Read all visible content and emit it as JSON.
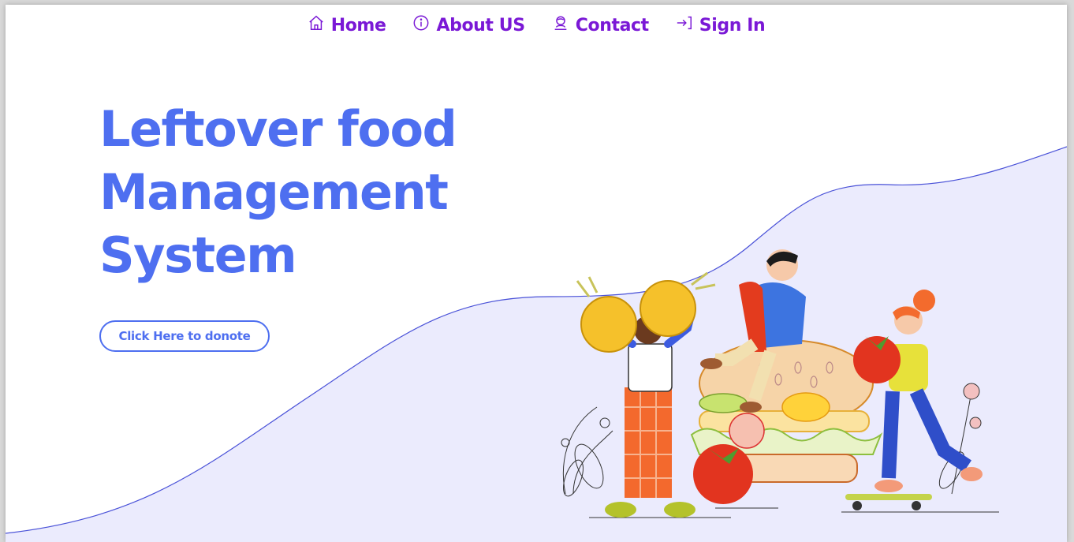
{
  "nav": {
    "items": [
      {
        "label": "Home",
        "icon": "home-icon"
      },
      {
        "label": "About US",
        "icon": "info-icon"
      },
      {
        "label": "Contact",
        "icon": "contact-icon"
      },
      {
        "label": "Sign In",
        "icon": "sign-in-icon"
      }
    ]
  },
  "hero": {
    "title_lines": [
      "Leftover food",
      "Management",
      "System"
    ],
    "button_label": "Click Here to donote"
  },
  "colors": {
    "nav_text": "#7a18d6",
    "headline": "#4e6ff0",
    "wave_fill": "#ebebfd",
    "wave_stroke": "#4a52d8"
  }
}
